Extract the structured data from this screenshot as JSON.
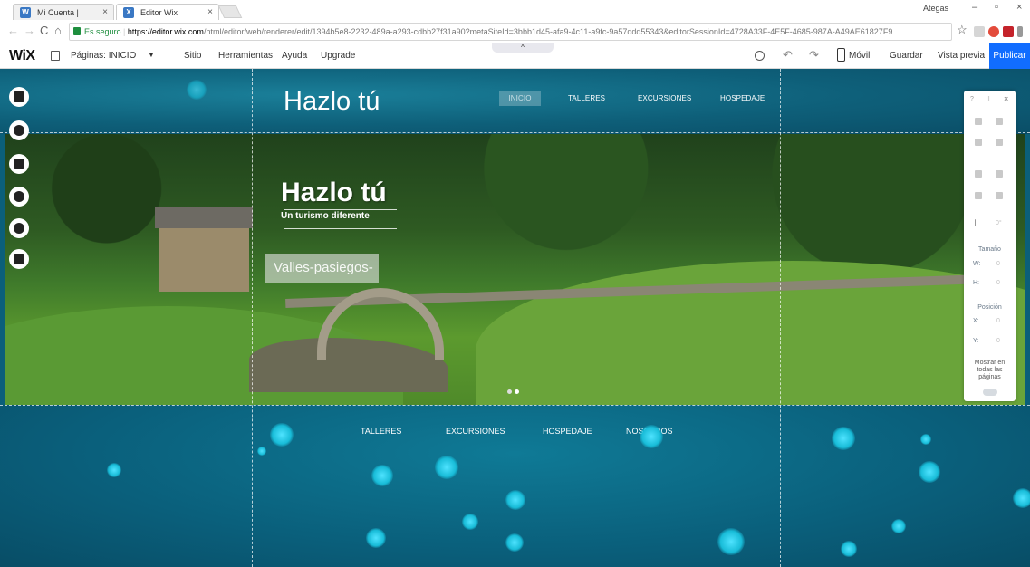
{
  "browser": {
    "tabs": [
      {
        "title": "Mi Cuenta | Wix.com",
        "favicon": "wix-favicon"
      },
      {
        "title": "Editor Wix",
        "favicon": "wix-favicon"
      }
    ],
    "profile_name": "Ategas",
    "secure_label": "Es seguro",
    "url_host": "https://editor.wix.com",
    "url_path": "/html/editor/web/renderer/edit/1394b5e8-2232-489a-a293-cdbb27f31a90?metaSiteId=3bbb1d45-afa9-4c11-a9fc-9a57ddd55343&editorSessionId=4728A33F-4E5F-4685-987A-A49AE61827F9"
  },
  "editor": {
    "logo": "WiX",
    "pages_label": "Páginas: INICIO",
    "menu": [
      "Sitio",
      "Herramientas",
      "Ayuda",
      "Upgrade"
    ],
    "mobile_label": "Móvil",
    "save_label": "Guardar",
    "preview_label": "Vista previa",
    "publish_label": "Publicar",
    "accent_color": "#116dff"
  },
  "site": {
    "title": "Hazlo tú",
    "nav": [
      "INICIO",
      "TALLERES",
      "EXCURSIONES",
      "HOSPEDAJE"
    ],
    "hero_title": "Hazlo tú",
    "hero_subtitle": "Un turismo diferente",
    "hero_button": "Valles-pasiegos-",
    "footer_nav": [
      "TALLERES",
      "EXCURSIONES",
      "HOSPEDAJE",
      "NOSOTROS"
    ]
  },
  "panel": {
    "top_icons": [
      "?",
      "⠿",
      "×"
    ],
    "size_label": "Tamaño",
    "w_label": "W:",
    "w_value": "0",
    "h_label": "H:",
    "h_value": "0",
    "position_label": "Posición",
    "x_label": "X:",
    "x_value": "0",
    "y_label": "Y:",
    "y_value": "0",
    "show_all_label": "Mostrar en todas las páginas",
    "rotation_value": "0°"
  }
}
